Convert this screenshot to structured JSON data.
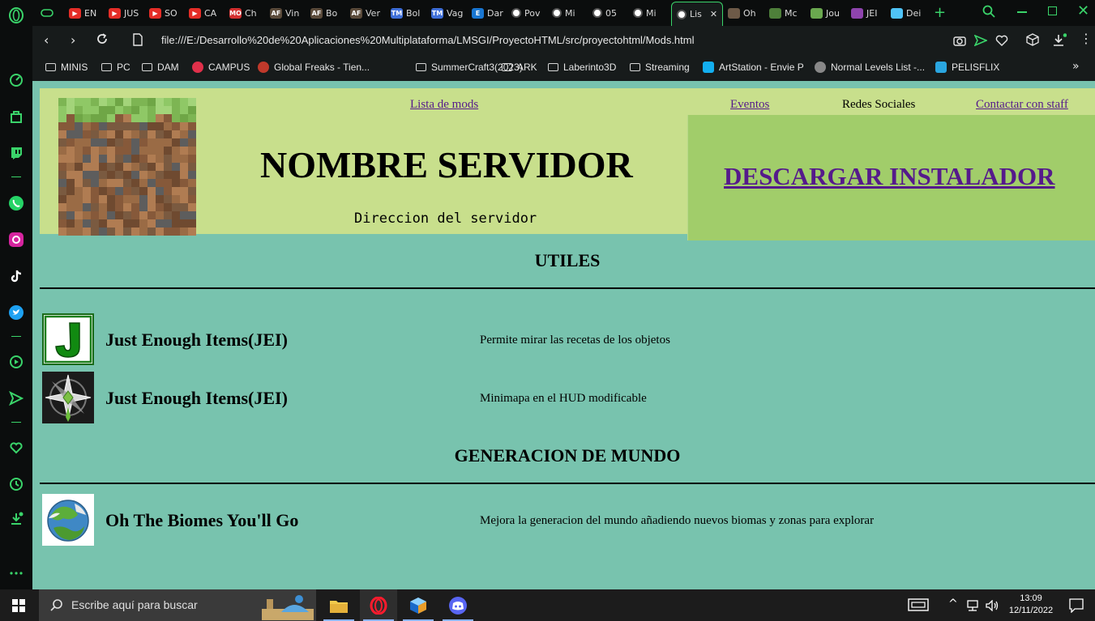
{
  "browser": {
    "tabs": [
      {
        "label": "EN",
        "icon": "youtube-icon",
        "color": "#e52d27"
      },
      {
        "label": "JUS",
        "icon": "youtube-icon",
        "color": "#e52d27"
      },
      {
        "label": "SO",
        "icon": "youtube-icon",
        "color": "#e52d27"
      },
      {
        "label": "CA",
        "icon": "youtube-icon",
        "color": "#e52d27"
      },
      {
        "label": "Ch",
        "icon": "mo-icon",
        "color": "#d32f2f"
      },
      {
        "label": "Vin",
        "icon": "af-icon",
        "color": "#5a4a3a"
      },
      {
        "label": "Bo",
        "icon": "af-icon",
        "color": "#5a4a3a"
      },
      {
        "label": "Ver",
        "icon": "af-icon",
        "color": "#5a4a3a"
      },
      {
        "label": "Bol",
        "icon": "tm-icon",
        "color": "#3f6fd8"
      },
      {
        "label": "Vag",
        "icon": "tm-icon",
        "color": "#3f6fd8"
      },
      {
        "label": "Dar",
        "icon": "e-icon",
        "color": "#1976d2"
      },
      {
        "label": "Pov",
        "icon": "globe-icon",
        "color": "#e6e6e6"
      },
      {
        "label": "Mi",
        "icon": "globe-icon",
        "color": "#e6e6e6"
      },
      {
        "label": "05",
        "icon": "globe-icon",
        "color": "#e6e6e6"
      },
      {
        "label": "Mi",
        "icon": "globe-icon",
        "color": "#e6e6e6"
      },
      {
        "label": "Lis",
        "icon": "globe-icon",
        "color": "#e6e6e6",
        "active": true
      },
      {
        "label": "Oh",
        "icon": "wolf-icon",
        "color": "#6d5a48"
      },
      {
        "label": "Mc",
        "icon": "cube-icon",
        "color": "#4e7f3a"
      },
      {
        "label": "Jou",
        "icon": "grass-icon",
        "color": "#6aa84f"
      },
      {
        "label": "JEI",
        "icon": "bars-icon",
        "color": "#8e44ad"
      },
      {
        "label": "Dei",
        "icon": "diamond-icon",
        "color": "#4fc3f7"
      }
    ],
    "url": "file:///E:/Desarrollo%20de%20Aplicaciones%20Multiplataforma/LMSGI/ProyectoHTML/src/proyectohtml/Mods.html",
    "bookmarks": [
      {
        "label": "MINIS",
        "icon": "folder-icon"
      },
      {
        "label": "PC",
        "icon": "folder-icon"
      },
      {
        "label": "DAM",
        "icon": "folder-icon"
      },
      {
        "label": "CAMPUS",
        "icon": "campus-icon"
      },
      {
        "label": "Global Freaks - Tien...",
        "icon": "freaks-icon"
      },
      {
        "label": "SummerCraft3(2023)",
        "icon": "folder-icon"
      },
      {
        "label": "ARK",
        "icon": "folder-icon"
      },
      {
        "label": "Laberinto3D",
        "icon": "folder-icon"
      },
      {
        "label": "Streaming",
        "icon": "folder-icon"
      },
      {
        "label": "ArtStation - Envie P",
        "icon": "artstation-icon"
      },
      {
        "label": "Normal Levels List -...",
        "icon": "wolf-icon"
      },
      {
        "label": "PELISFLIX",
        "icon": "p-icon"
      }
    ]
  },
  "header": {
    "nav": {
      "lista": "Lista de mods",
      "eventos": "Eventos",
      "redes": "Redes Sociales",
      "staff": "Contactar con staff"
    },
    "server_name": "NOMBRE SERVIDOR",
    "server_address": "Direccion del servidor",
    "download": "DESCARGAR INSTALADOR"
  },
  "sections": [
    {
      "title": "UTILES",
      "mods": [
        {
          "name": "Just Enough Items(JEI)",
          "desc": "Permite mirar las recetas de los objetos",
          "icon": "jei-icon"
        },
        {
          "name": "Just Enough Items(JEI)",
          "desc": "Minimapa en el HUD modificable",
          "icon": "compass-icon"
        }
      ]
    },
    {
      "title": "GENERACION DE MUNDO",
      "mods": [
        {
          "name": "Oh The Biomes You'll Go",
          "desc": "Mejora la generacion del mundo añadiendo nuevos biomas y zonas para explorar",
          "icon": "globe-biomes-icon"
        }
      ]
    }
  ],
  "taskbar": {
    "search_placeholder": "Escribe aquí para buscar",
    "time": "13:09",
    "date": "12/11/2022"
  }
}
